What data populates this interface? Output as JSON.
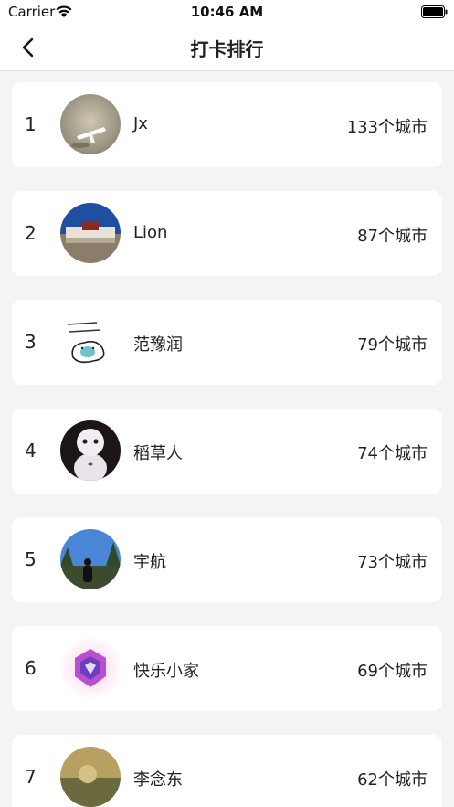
{
  "status_bar": {
    "carrier": "Carrier",
    "time": "10:46 AM"
  },
  "nav": {
    "title": "打卡排行"
  },
  "ranking": [
    {
      "rank": "1",
      "name": "Jx",
      "cities": "133个城市"
    },
    {
      "rank": "2",
      "name": "Lion",
      "cities": "87个城市"
    },
    {
      "rank": "3",
      "name": "范豫润",
      "cities": "79个城市"
    },
    {
      "rank": "4",
      "name": "稻草人",
      "cities": "74个城市"
    },
    {
      "rank": "5",
      "name": "宇航",
      "cities": "73个城市"
    },
    {
      "rank": "6",
      "name": "快乐小家",
      "cities": "69个城市"
    },
    {
      "rank": "7",
      "name": "李念东",
      "cities": "62个城市"
    }
  ],
  "colors": {
    "background": "#f4f4f6",
    "card": "#ffffff",
    "text": "#222222"
  }
}
